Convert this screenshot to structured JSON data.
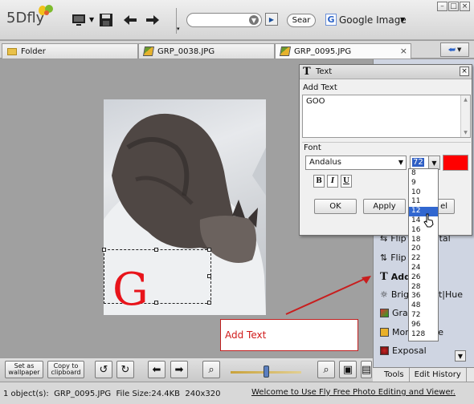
{
  "app": {
    "logo": "5Dfly"
  },
  "toolbar": {
    "search_placeholder": "",
    "search_button": "Sear",
    "google_label": "Google Image",
    "google_letter": "G"
  },
  "tabs": [
    {
      "label": "Folder"
    },
    {
      "label": "GRP_0038.JPG"
    },
    {
      "label": "GRP_0095.JPG"
    }
  ],
  "canvas": {
    "overlay_letter": "G",
    "overlay_color": "#e8141b"
  },
  "dialog": {
    "title": "Text",
    "add_text_label": "Add Text",
    "text_value": "GOO",
    "font_label": "Font",
    "font_name": "Andalus",
    "font_size": "72",
    "color": "#ff0000",
    "format_buttons": [
      "B",
      "I",
      "U"
    ],
    "ok": "OK",
    "apply": "Apply",
    "cancel_partial": "el"
  },
  "size_options": [
    "8",
    "9",
    "10",
    "11",
    "12",
    "14",
    "16",
    "18",
    "20",
    "22",
    "24",
    "26",
    "28",
    "36",
    "48",
    "72",
    "96",
    "128"
  ],
  "size_highlighted": "12",
  "right_panel": {
    "items": [
      {
        "label": "Flip Horizontal",
        "visible": "Flip",
        "tail": "ntal",
        "icon": "flip-icon"
      },
      {
        "label": "Flip",
        "visible": "Flip",
        "icon": "flip-icon"
      },
      {
        "label": "Add",
        "visible": "Add",
        "icon": "text-icon"
      },
      {
        "label": "Brightness Contrast|Hue",
        "visible": "Brig",
        "tail": "rast|Hue",
        "icon": "sun-icon"
      },
      {
        "label": "Gra",
        "visible": "Gra",
        "icon": "grayscale-icon"
      },
      {
        "label": "Mono",
        "visible": "Mon",
        "tail": "e",
        "icon": "mono-icon"
      },
      {
        "label": "Exposal",
        "visible": "Exposal",
        "icon": "exposure-icon"
      }
    ],
    "tabs": [
      "Tools",
      "Edit History"
    ]
  },
  "callout": {
    "text": "Add Text"
  },
  "bottom": {
    "set_wallpaper": "Set as wallpaper",
    "copy_clipboard": "Copy to clipboard",
    "zoom_level": 0.5
  },
  "status": {
    "objects": "1 object(s):  GRP_0095.JPG  File Size:24.4KB  240x320",
    "welcome": "Welcome to Use Fly Free Photo Editing and Viewer."
  }
}
